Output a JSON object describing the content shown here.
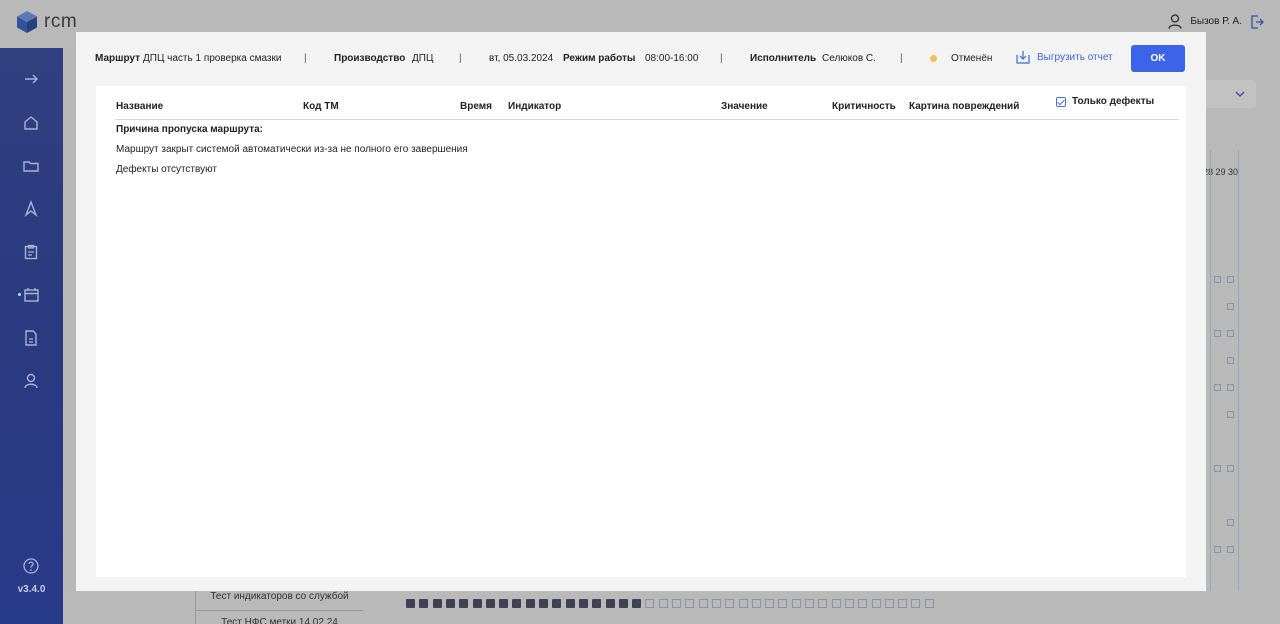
{
  "app": {
    "logo_text": "rcm",
    "version": "v3.4.0",
    "user_name": "Бызов Р. А."
  },
  "sidebar": {
    "icons": [
      "arrow-right-icon",
      "home-icon",
      "folder-icon",
      "route-icon",
      "clipboard-icon",
      "calendar-icon",
      "document-icon",
      "user-icon",
      "help-icon"
    ]
  },
  "background": {
    "days_label": "28 29 30",
    "row1": "Тест индикаторов со службой",
    "row2": "Тест НФС метки 14.02.24"
  },
  "modal": {
    "route_label": "Маршрут",
    "route_value": "ДПЦ часть 1 проверка смазки",
    "production_label": "Производство",
    "production_value": "ДПЦ",
    "date": "вт, 05.03.2024",
    "work_mode_label": "Режим работы",
    "work_mode_value": "08:00-16:00",
    "executor_label": "Исполнитель",
    "executor_value": "Селюков С.",
    "separator": "|",
    "status": "Отменён",
    "export_label": "Выгрузить отчет",
    "ok_label": "OK"
  },
  "table": {
    "columns": [
      "Название",
      "Код ТМ",
      "Время",
      "Индикатор",
      "Значение",
      "Критичность",
      "Картина повреждений"
    ],
    "only_defects_label": "Только дефекты",
    "only_defects_checked": true
  },
  "content": {
    "skip_reason_title": "Причина пропуска маршрута:",
    "skip_reason_text": "Маршрут закрыт системой автоматически из-за не полного его завершения",
    "no_defects": "Дефекты отсутствуют"
  },
  "colors": {
    "accent": "#3d63e8",
    "sidebar": "#2a3a80",
    "status_cancelled": "#f2c14e"
  }
}
